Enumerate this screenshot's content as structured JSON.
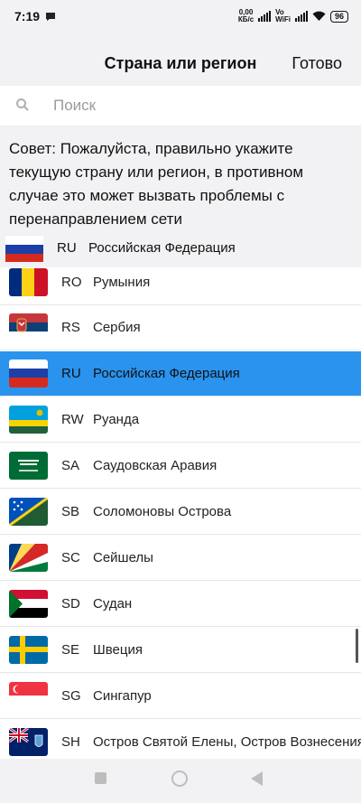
{
  "status_bar": {
    "time": "7:19",
    "speed": "0,00\nКБ/с",
    "vo": "Vo\nWiFi",
    "battery": "96"
  },
  "header": {
    "title": "Страна или регион",
    "done_label": "Готово"
  },
  "search": {
    "placeholder": "Поиск"
  },
  "tip": "Совет: Пожалуйста, правильно укажите текущую страну или регион, в противном случае это может вызвать проблемы с перенаправлением сети",
  "current": {
    "code": "RU",
    "name": "Российская Федерация",
    "flag_icon": "flag-ru-icon"
  },
  "list": [
    {
      "code": "RO",
      "name": "Румыния",
      "flag_icon": "flag-ro-icon"
    },
    {
      "code": "RS",
      "name": "Сербия",
      "flag_icon": "flag-rs-icon"
    },
    {
      "code": "RU",
      "name": "Российская Федерация",
      "flag_icon": "flag-ru-icon",
      "selected": true
    },
    {
      "code": "RW",
      "name": "Руанда",
      "flag_icon": "flag-rw-icon"
    },
    {
      "code": "SA",
      "name": "Саудовская Аравия",
      "flag_icon": "flag-sa-icon"
    },
    {
      "code": "SB",
      "name": "Соломоновы Острова",
      "flag_icon": "flag-sb-icon"
    },
    {
      "code": "SC",
      "name": "Сейшелы",
      "flag_icon": "flag-sc-icon"
    },
    {
      "code": "SD",
      "name": "Судан",
      "flag_icon": "flag-sd-icon"
    },
    {
      "code": "SE",
      "name": "Швеция",
      "flag_icon": "flag-se-icon"
    },
    {
      "code": "SG",
      "name": "Сингапур",
      "flag_icon": "flag-sg-icon"
    },
    {
      "code": "SH",
      "name": "Остров Святой Елены, Остров Вознесения",
      "flag_icon": "flag-sh-icon"
    }
  ],
  "colors": {
    "selected_row": "#2a93ee",
    "background": "#f2f2f4"
  }
}
